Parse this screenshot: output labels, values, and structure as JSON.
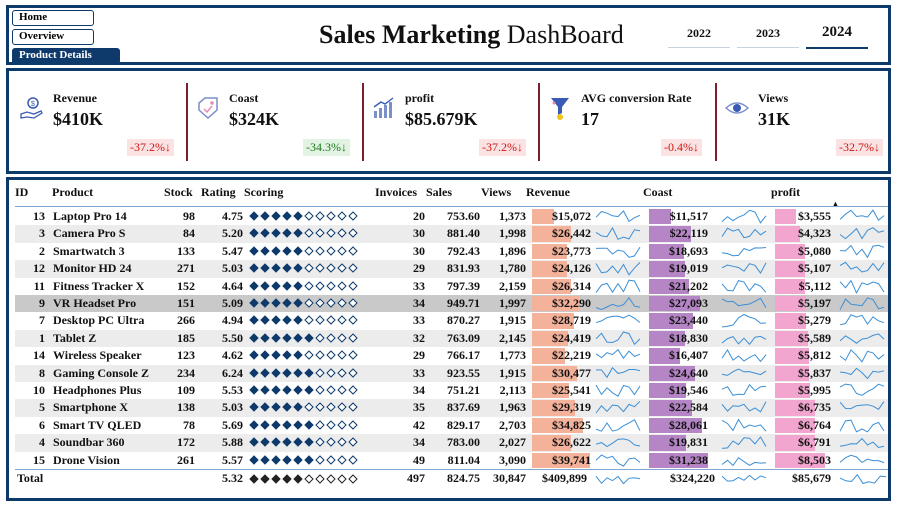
{
  "nav": [
    "Home",
    "Overview",
    "Product Details"
  ],
  "title_bold": "Sales Marketing",
  "title_rest": " DashBoard",
  "years": [
    "2022",
    "2023",
    "2024"
  ],
  "active_year": "2024",
  "kpis": [
    {
      "label": "Revenue",
      "value": "$410K",
      "delta": "-37.2%↓",
      "trend": "neg",
      "icon": "money-hand-icon"
    },
    {
      "label": "Coast",
      "value": "$324K",
      "delta": "-34.3%↓",
      "trend": "pos",
      "icon": "price-tag-icon"
    },
    {
      "label": "profit",
      "value": "$85.679K",
      "delta": "-37.2%↓",
      "trend": "neg",
      "icon": "bar-growth-icon"
    },
    {
      "label": "AVG conversion Rate",
      "value": "17",
      "delta": "-0.4%↓",
      "trend": "neg",
      "icon": "funnel-icon"
    },
    {
      "label": "Views",
      "value": "31K",
      "delta": "-32.7%↓",
      "trend": "neg",
      "icon": "eye-icon"
    }
  ],
  "colors": {
    "navy": "#0d3a6b",
    "revenue_bar": "#f4b29a",
    "coast_bar": "#b585c6",
    "profit_bar": "#f2a6cf",
    "spark": "#3b8fd6",
    "diamond": "#0d3a6b"
  },
  "columns": [
    "ID",
    "Product",
    "Stock",
    "Rating",
    "Scoring",
    "Invoices",
    "Sales",
    "Views",
    "Revenue",
    "Coast",
    "profit"
  ],
  "rows": [
    {
      "id": "13",
      "product": "Laptop Pro 14",
      "stock": "98",
      "rating": "4.75",
      "score": 5,
      "invoices": "20",
      "sales": "753.60",
      "views": "1,373",
      "revenue": "$15,072",
      "coast": "$11,517",
      "profit": "$3,555"
    },
    {
      "id": "3",
      "product": "Camera Pro S",
      "stock": "84",
      "rating": "5.20",
      "score": 5,
      "invoices": "30",
      "sales": "881.40",
      "views": "1,998",
      "revenue": "$26,442",
      "coast": "$22,119",
      "profit": "$4,323"
    },
    {
      "id": "2",
      "product": "Smartwatch 3",
      "stock": "133",
      "rating": "5.47",
      "score": 5,
      "invoices": "30",
      "sales": "792.43",
      "views": "1,896",
      "revenue": "$23,773",
      "coast": "$18,693",
      "profit": "$5,080"
    },
    {
      "id": "12",
      "product": "Monitor HD 24",
      "stock": "271",
      "rating": "5.03",
      "score": 5,
      "invoices": "29",
      "sales": "831.93",
      "views": "1,780",
      "revenue": "$24,126",
      "coast": "$19,019",
      "profit": "$5,107"
    },
    {
      "id": "11",
      "product": "Fitness Tracker X",
      "stock": "152",
      "rating": "4.64",
      "score": 5,
      "invoices": "33",
      "sales": "797.39",
      "views": "2,159",
      "revenue": "$26,314",
      "coast": "$21,202",
      "profit": "$5,112"
    },
    {
      "id": "9",
      "product": "VR Headset Pro",
      "stock": "151",
      "rating": "5.09",
      "score": 5,
      "invoices": "34",
      "sales": "949.71",
      "views": "1,997",
      "revenue": "$32,290",
      "coast": "$27,093",
      "profit": "$5,197"
    },
    {
      "id": "7",
      "product": "Desktop PC Ultra",
      "stock": "266",
      "rating": "4.94",
      "score": 5,
      "invoices": "33",
      "sales": "870.27",
      "views": "1,915",
      "revenue": "$28,719",
      "coast": "$23,440",
      "profit": "$5,279"
    },
    {
      "id": "1",
      "product": "Tablet Z",
      "stock": "185",
      "rating": "5.50",
      "score": 6,
      "invoices": "32",
      "sales": "763.09",
      "views": "2,145",
      "revenue": "$24,419",
      "coast": "$18,830",
      "profit": "$5,589"
    },
    {
      "id": "14",
      "product": "Wireless Speaker",
      "stock": "123",
      "rating": "4.62",
      "score": 5,
      "invoices": "29",
      "sales": "766.17",
      "views": "1,773",
      "revenue": "$22,219",
      "coast": "$16,407",
      "profit": "$5,812"
    },
    {
      "id": "8",
      "product": "Gaming Console Z",
      "stock": "234",
      "rating": "6.24",
      "score": 6,
      "invoices": "33",
      "sales": "923.55",
      "views": "1,915",
      "revenue": "$30,477",
      "coast": "$24,640",
      "profit": "$5,837"
    },
    {
      "id": "10",
      "product": "Headphones Plus",
      "stock": "109",
      "rating": "5.53",
      "score": 6,
      "invoices": "34",
      "sales": "751.21",
      "views": "2,113",
      "revenue": "$25,541",
      "coast": "$19,546",
      "profit": "$5,995"
    },
    {
      "id": "5",
      "product": "Smartphone X",
      "stock": "138",
      "rating": "5.03",
      "score": 5,
      "invoices": "35",
      "sales": "837.69",
      "views": "1,963",
      "revenue": "$29,319",
      "coast": "$22,584",
      "profit": "$6,735"
    },
    {
      "id": "6",
      "product": "Smart TV QLED",
      "stock": "78",
      "rating": "5.69",
      "score": 6,
      "invoices": "42",
      "sales": "829.17",
      "views": "2,703",
      "revenue": "$34,825",
      "coast": "$28,061",
      "profit": "$6,764"
    },
    {
      "id": "4",
      "product": "Soundbar 360",
      "stock": "172",
      "rating": "5.88",
      "score": 6,
      "invoices": "34",
      "sales": "783.00",
      "views": "2,027",
      "revenue": "$26,622",
      "coast": "$19,831",
      "profit": "$6,791"
    },
    {
      "id": "15",
      "product": "Drone Vision",
      "stock": "261",
      "rating": "5.57",
      "score": 6,
      "invoices": "49",
      "sales": "811.04",
      "views": "3,090",
      "revenue": "$39,741",
      "coast": "$31,238",
      "profit": "$8,503"
    }
  ],
  "selected_row": 5,
  "total": {
    "label": "Total",
    "rating": "5.32",
    "score": 5,
    "invoices": "497",
    "sales": "824.75",
    "views": "30,847",
    "revenue": "$409,899",
    "coast": "$324,220",
    "profit": "$85,679"
  }
}
